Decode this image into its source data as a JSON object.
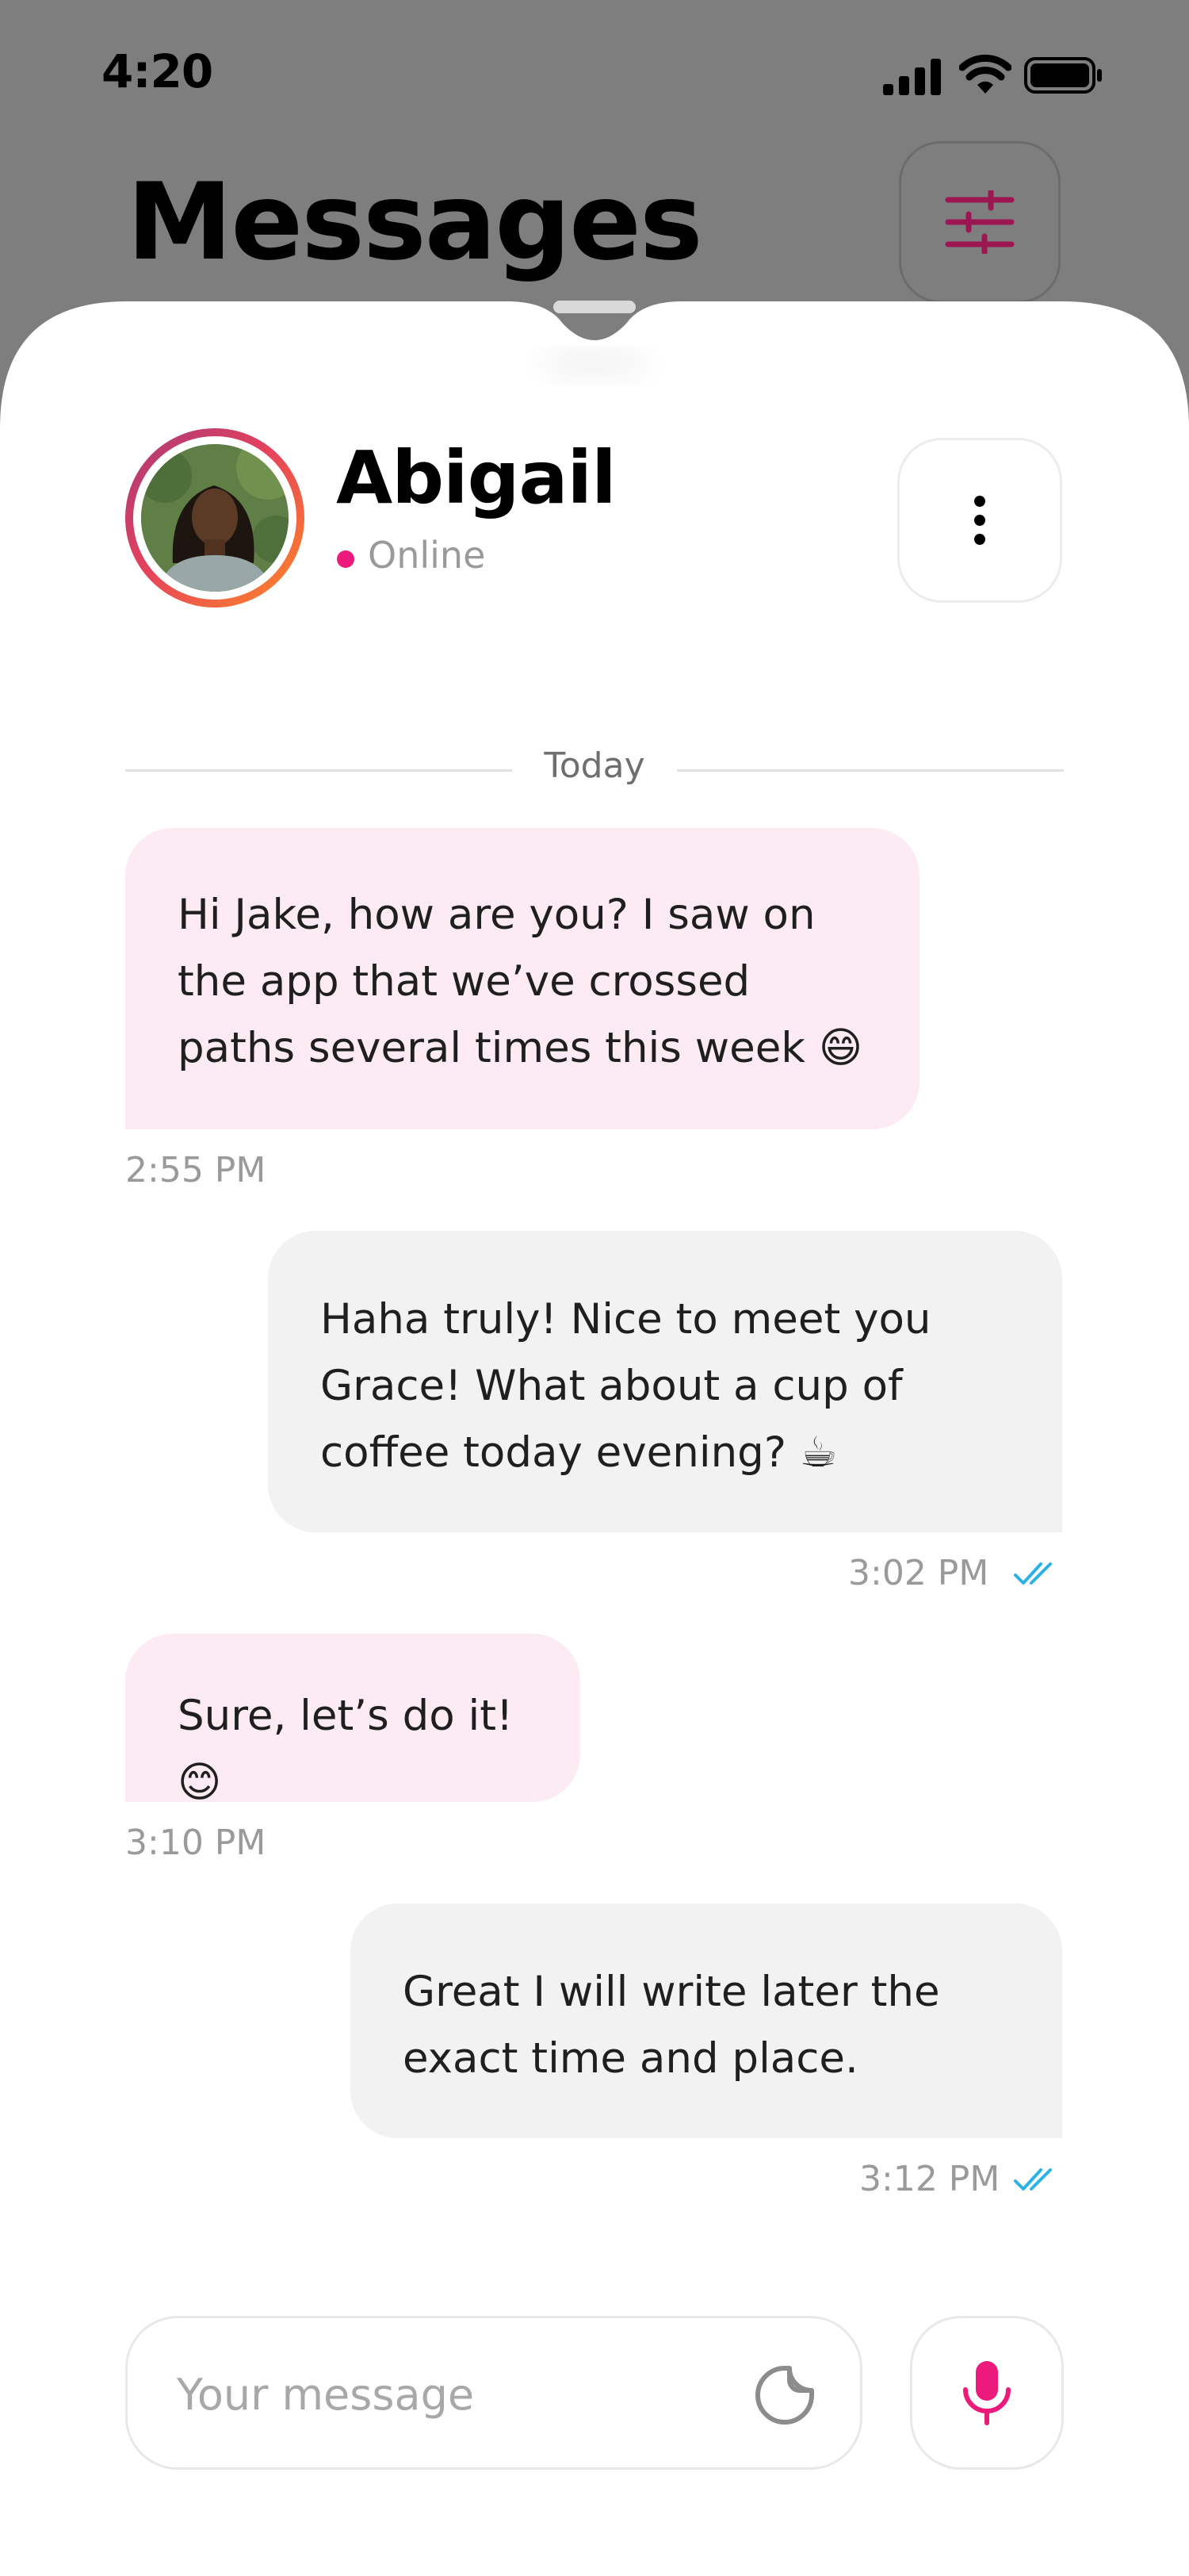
{
  "status_bar": {
    "time": "4:20"
  },
  "header": {
    "title": "Messages"
  },
  "contact": {
    "name": "Abigail",
    "status": "Online"
  },
  "conversation": {
    "date_divider": "Today",
    "messages": [
      {
        "direction": "incoming",
        "text": "Hi Jake, how are you? I saw on the app that we’ve crossed paths several times this week 😄",
        "time": "2:55 PM"
      },
      {
        "direction": "outgoing",
        "text": "Haha truly! Nice to meet you Grace! What about a cup of coffee today evening? ☕",
        "time": "3:02 PM",
        "read": true
      },
      {
        "direction": "incoming",
        "text": "Sure, let’s do it! 😊",
        "time": "3:10 PM"
      },
      {
        "direction": "outgoing",
        "text": "Great I will write later the exact time and place.",
        "time": "3:12 PM",
        "read": true
      }
    ]
  },
  "composer": {
    "placeholder": "Your message"
  },
  "icons": {
    "filter": "sliders-icon",
    "more": "vertical-dots-icon",
    "sticker": "sticker-icon",
    "mic": "microphone-icon",
    "read": "double-check-icon"
  },
  "colors": {
    "accent": "#ec1a7b",
    "filter_icon": "#9c1752",
    "incoming_bubble": "#fdebf3",
    "outgoing_bubble": "#f2f2f2",
    "read_ticks": "#2bb3e3",
    "backdrop": "#7e7e7e"
  }
}
